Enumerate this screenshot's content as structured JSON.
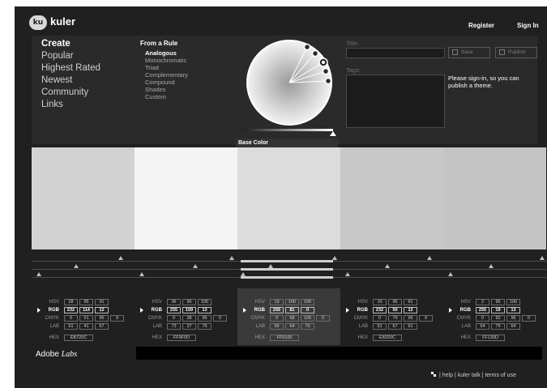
{
  "header": {
    "logo_badge": "ku",
    "logo_text": "kuler",
    "register": "Register",
    "sign_in": "Sign In"
  },
  "nav": {
    "items": [
      {
        "label": "Create",
        "active": true
      },
      {
        "label": "Popular"
      },
      {
        "label": "Highest Rated"
      },
      {
        "label": "Newest"
      },
      {
        "label": "Community"
      },
      {
        "label": "Links"
      }
    ]
  },
  "rules": {
    "title": "From a Rule",
    "items": [
      {
        "label": "Analogous",
        "active": true
      },
      {
        "label": "Monochromatic"
      },
      {
        "label": "Triad"
      },
      {
        "label": "Complementary"
      },
      {
        "label": "Compound"
      },
      {
        "label": "Shades"
      },
      {
        "label": "Custom"
      }
    ]
  },
  "wheel": {
    "base_color_label": "Base Color"
  },
  "theme_form": {
    "title_label": "Title:",
    "title_value": "",
    "tags_label": "Tags:",
    "tags_value": "",
    "save_label": "Save",
    "publish_label": "Publish",
    "signin_message": "Please sign-in, so you can publish a theme."
  },
  "swatches": [
    {
      "hex_display": "EB720C",
      "swatch_color": "#d2d2d2",
      "hsv": [
        "28",
        "95",
        "91"
      ],
      "rgb": [
        "232",
        "114",
        "12"
      ],
      "cmyk": [
        "0",
        "51",
        "95",
        "9"
      ],
      "lab": [
        "61",
        "41",
        "67"
      ],
      "selected": false
    },
    {
      "hex_display": "FF9F0D",
      "swatch_color": "#f4f4f4",
      "hsv": [
        "36",
        "95",
        "100"
      ],
      "rgb": [
        "255",
        "159",
        "13"
      ],
      "cmyk": [
        "0",
        "38",
        "95",
        "0"
      ],
      "lab": [
        "73",
        "27",
        "76"
      ],
      "selected": false
    },
    {
      "hex_display": "FF5100",
      "swatch_color": "#dcdcdc",
      "hsv": [
        "19",
        "100",
        "100"
      ],
      "rgb": [
        "255",
        "81",
        "0"
      ],
      "cmyk": [
        "0",
        "68",
        "100",
        "0"
      ],
      "lab": [
        "59",
        "64",
        "70"
      ],
      "selected": true
    },
    {
      "hex_display": "E8320C",
      "swatch_color": "#c8c8c8",
      "hsv": [
        "10",
        "95",
        "91"
      ],
      "rgb": [
        "232",
        "50",
        "12"
      ],
      "cmyk": [
        "0",
        "79",
        "95",
        "9"
      ],
      "lab": [
        "51",
        "67",
        "61"
      ],
      "selected": false
    },
    {
      "hex_display": "FF130D",
      "swatch_color": "#c4c4c4",
      "hsv": [
        "2",
        "95",
        "100"
      ],
      "rgb": [
        "255",
        "19",
        "13"
      ],
      "cmyk": [
        "0",
        "92",
        "95",
        "0"
      ],
      "lab": [
        "54",
        "79",
        "64"
      ],
      "selected": false
    }
  ],
  "labels": {
    "hsv": "HSV",
    "rgb": "RGB",
    "cmyk": "CMYK",
    "lab": "LAB",
    "hex": "HEX"
  },
  "footer": {
    "adobe": "Adobe",
    "labs": "Labs",
    "help": "help",
    "kuler_talk": "kuler talk",
    "terms": "terms of use",
    "sep": "|"
  },
  "colors": {
    "app_bg": "#202020",
    "panel_bg": "#2a2a2a",
    "text": "#ffffff"
  }
}
